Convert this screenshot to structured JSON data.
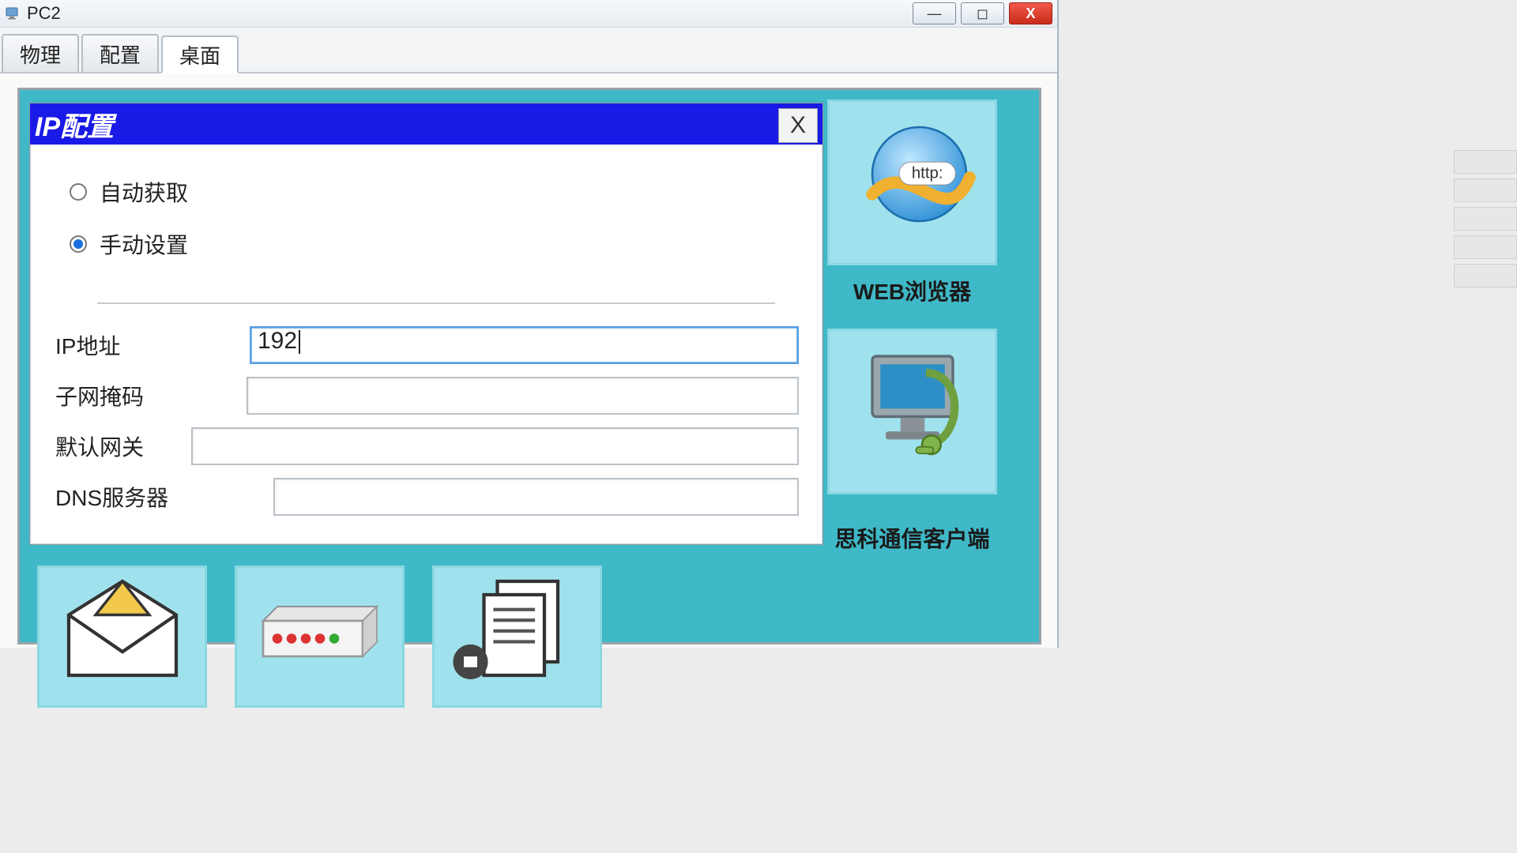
{
  "window": {
    "title": "PC2",
    "controls": {
      "min": "—",
      "max": "◻",
      "close": "X"
    }
  },
  "tabs": [
    {
      "label": "物理",
      "active": false
    },
    {
      "label": "配置",
      "active": false
    },
    {
      "label": "桌面",
      "active": true
    }
  ],
  "sidebar": {
    "web": {
      "label": "WEB浏览器",
      "icon": "globe-http-icon",
      "http_text": "http:"
    },
    "cisco": {
      "label": "思科通信客户端",
      "icon": "pc-headset-icon"
    }
  },
  "bottom_tiles": {
    "mail": {
      "icon": "mail-envelope-icon"
    },
    "hw": {
      "icon": "network-device-icon"
    },
    "doc": {
      "icon": "document-stack-icon"
    }
  },
  "ip_dialog": {
    "title": "IP配置",
    "close": "X",
    "radios": {
      "auto": {
        "label": "自动获取",
        "selected": false
      },
      "manual": {
        "label": "手动设置",
        "selected": true
      }
    },
    "fields": {
      "ip": {
        "label": "IP地址",
        "value": "192"
      },
      "mask": {
        "label": "子网掩码",
        "value": ""
      },
      "gateway": {
        "label": "默认网关",
        "value": ""
      },
      "dns": {
        "label": "DNS服务器",
        "value": ""
      }
    }
  }
}
